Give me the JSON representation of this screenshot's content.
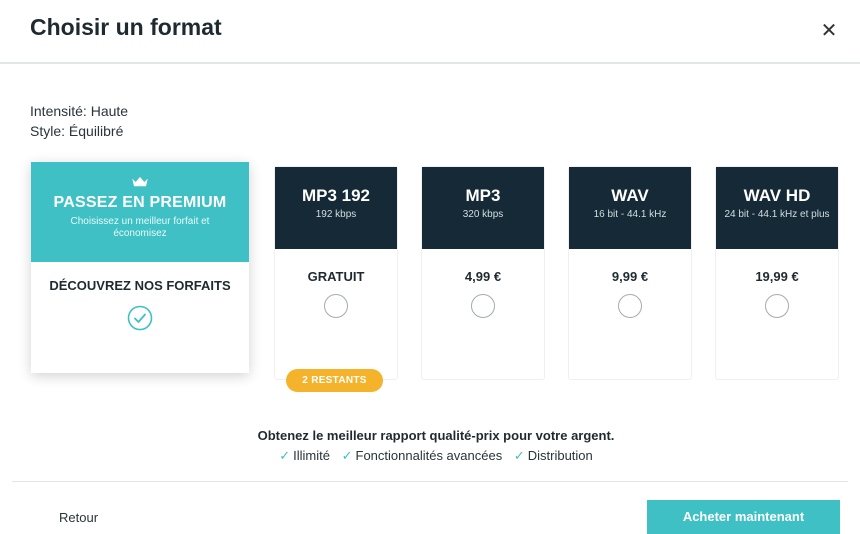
{
  "dialog": {
    "title": "Choisir un format",
    "close_icon": "close-icon"
  },
  "meta": {
    "intensity": "Intensité: Haute",
    "style": "Style: Équilibré"
  },
  "premium": {
    "icon": "crown-icon",
    "title": "PASSEZ EN PREMIUM",
    "subtitle": "Choisissez un meilleur forfait et économisez",
    "cta": "DÉCOUVREZ NOS FORFAITS",
    "status_icon": "check-circle-icon"
  },
  "formats": [
    {
      "name": "MP3 192",
      "desc": "192 kbps",
      "price": "GRATUIT"
    },
    {
      "name": "MP3",
      "desc": "320 kbps",
      "price": "4,99 €"
    },
    {
      "name": "WAV",
      "desc": "16 bit - 44.1 kHz",
      "price": "9,99 €"
    },
    {
      "name": "WAV HD",
      "desc": "24 bit - 44.1 kHz et plus",
      "price": "19,99 €"
    }
  ],
  "badge": "2 RESTANTS",
  "promo": {
    "text": "Obtenez le meilleur rapport qualité-prix pour votre argent.",
    "features": [
      "Illimité",
      "Fonctionnalités avancées",
      "Distribution"
    ]
  },
  "footer": {
    "back": "Retour",
    "buy": "Acheter maintenant"
  },
  "colors": {
    "accent": "#3fc0c4",
    "dark": "#152a36",
    "badge": "#f5b32b"
  }
}
